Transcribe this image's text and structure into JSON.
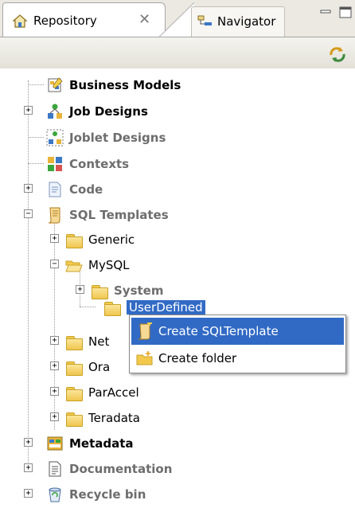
{
  "tabs": [
    {
      "label": "Repository",
      "icon": "repository-icon",
      "active": true
    },
    {
      "label": "Navigator",
      "icon": "navigator-icon",
      "active": false
    }
  ],
  "toolbar": {
    "sync_icon": "synchronize-icon"
  },
  "tree": {
    "business_models": "Business Models",
    "job_designs": "Job Designs",
    "joblet_designs": "Joblet Designs",
    "contexts": "Contexts",
    "code": "Code",
    "sql_templates": "SQL Templates",
    "generic": "Generic",
    "mysql": "MySQL",
    "system": "System",
    "user_defined": "UserDefined",
    "netezza": "Net",
    "oracle": "Ora",
    "paraccel": "ParAccel",
    "teradata": "Teradata",
    "metadata": "Metadata",
    "documentation": "Documentation",
    "recycle_bin": "Recycle bin"
  },
  "context_menu": {
    "create_sqltemplate": "Create SQLTemplate",
    "create_folder": "Create folder"
  },
  "colors": {
    "selection": "#316ac5",
    "folder": "#f2c94c",
    "tab_background": "#ebe9e2"
  }
}
